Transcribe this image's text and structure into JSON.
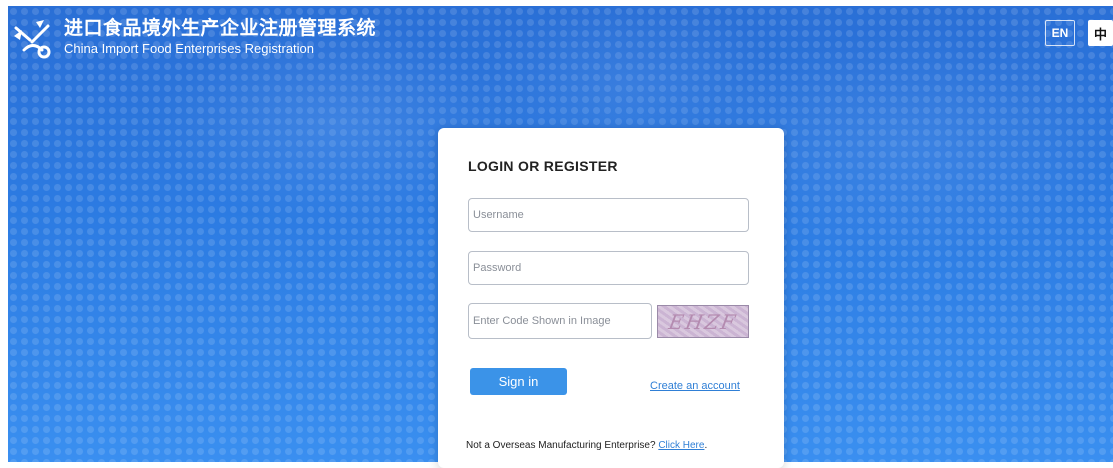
{
  "header": {
    "title_cn": "进口食品境外生产企业注册管理系统",
    "title_en": "China Import Food Enterprises Registration",
    "logo_icon": "scale-ribbon-logo-icon"
  },
  "language": {
    "en_label": "EN",
    "zh_label": "中"
  },
  "login": {
    "title": "LOGIN OR REGISTER",
    "username_placeholder": "Username",
    "password_placeholder": "Password",
    "code_placeholder": "Enter Code Shown in Image",
    "captcha_text": "EHZF",
    "signin_label": "Sign in",
    "create_account_label": "Create an account",
    "footer_text": "Not a Overseas Manufacturing Enterprise? ",
    "footer_link": "Click Here",
    "footer_suffix": "."
  },
  "colors": {
    "background": "#2c7be2",
    "button": "#3b93e8",
    "link": "#2f7fd6"
  }
}
